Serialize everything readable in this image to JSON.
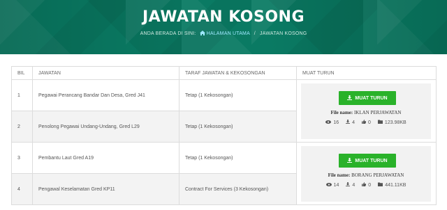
{
  "header": {
    "title": "JAWATAN KOSONG",
    "breadcrumb": {
      "prefix": "ANDA BERADA DI SINI:",
      "home": "HALAMAN UTAMA",
      "separator": "/",
      "current": "JAWATAN KOSONG"
    }
  },
  "table": {
    "headers": [
      "BIL",
      "JAWATAN",
      "TARAF JAWATAN & KEKOSONGAN",
      "MUAT TURUN"
    ],
    "rows": [
      {
        "bil": "1",
        "jawatan": "Pegawai Perancang Bandar Dan Desa, Gred J41",
        "taraf": "Tetap (1 Kekosongan)"
      },
      {
        "bil": "2",
        "jawatan": "Penolong Pegawai Undang-Undang, Gred L29",
        "taraf": "Tetap (1 Kekosongan)"
      },
      {
        "bil": "3",
        "jawatan": "Pembantu Laut Gred A19",
        "taraf": "Tetap (1 Kekosongan)"
      },
      {
        "bil": "4",
        "jawatan": "Pengawal Keselamatan Gred KP11",
        "taraf": "Contract For Services (3 Kekosongan)"
      }
    ]
  },
  "downloads": [
    {
      "button_label": "MUAT TURUN",
      "file_label": "File name:",
      "file_name": "IKLAN PERJAWATAN",
      "views": "16",
      "downloads": "4",
      "likes": "0",
      "size": "123.98KB"
    },
    {
      "button_label": "MUAT TURUN",
      "file_label": "File name:",
      "file_name": "BORANG PERJAWATAN",
      "views": "14",
      "downloads": "4",
      "likes": "0",
      "size": "441.11KB"
    }
  ],
  "icons": {
    "home": "home-icon",
    "download": "download-icon",
    "eye": "eye-icon",
    "thumb": "thumbs-up-icon",
    "folder": "folder-icon"
  },
  "colors": {
    "header_bg": "#0a7a63",
    "button": "#2ab22a",
    "link": "#9ee8ff"
  }
}
